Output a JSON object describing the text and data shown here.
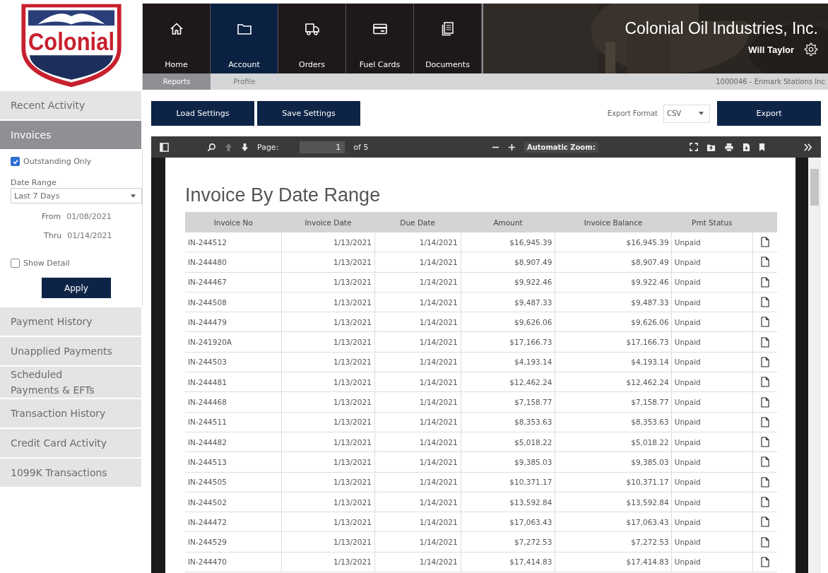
{
  "logo": {
    "text": "Colonial"
  },
  "sidebar": {
    "items_top": [
      {
        "label": "Recent Activity",
        "selected": false
      },
      {
        "label": "Invoices",
        "selected": true
      }
    ],
    "filters": {
      "outstanding": {
        "label": "Outstanding Only",
        "checked": true
      },
      "date_range": {
        "label": "Date Range",
        "value": "Last 7 Days"
      },
      "from": {
        "label": "From",
        "value": "01/08/2021"
      },
      "thru": {
        "label": "Thru",
        "value": "01/14/2021"
      },
      "show_detail": {
        "label": "Show Detail",
        "checked": false
      },
      "apply": "Apply"
    },
    "items_bottom": [
      {
        "label": "Payment History",
        "selected": false
      },
      {
        "label": "Unapplied Payments",
        "selected": false
      },
      {
        "label": "Scheduled Payments & EFTs",
        "selected": false
      },
      {
        "label": "Transaction History",
        "selected": false
      },
      {
        "label": "Credit Card Activity",
        "selected": false
      },
      {
        "label": "1099K Transactions",
        "selected": false
      }
    ]
  },
  "nav": {
    "tabs": [
      {
        "label": "Home",
        "kind": "home",
        "selected": false
      },
      {
        "label": "Account",
        "kind": "folder",
        "selected": true
      },
      {
        "label": "Orders",
        "kind": "truck",
        "selected": false
      },
      {
        "label": "Fuel Cards",
        "kind": "card",
        "selected": false
      },
      {
        "label": "Documents",
        "kind": "documents",
        "selected": false
      }
    ],
    "company": "Colonial Oil Industries, Inc.",
    "user": "Will Taylor",
    "subtabs": [
      {
        "label": "Reports",
        "selected": true
      },
      {
        "label": "Profile",
        "selected": false
      }
    ],
    "account": "1000046 - Enmark Stations Inc"
  },
  "toolbar": {
    "buttons": [
      "Load Settings",
      "Save Settings"
    ],
    "export_label": "Export Format",
    "export_format": "CSV",
    "export_button": "Export"
  },
  "viewer": {
    "page_label": "Page:",
    "page": "1",
    "page_count": "of 5",
    "zoom": "Automatic Zoom:"
  },
  "report": {
    "title": "Invoice By Date Range",
    "columns": [
      "Invoice No",
      "Invoice Date",
      "Due Date",
      "Amount",
      "Invoice Balance",
      "Pmt Status"
    ],
    "rows": [
      [
        "IN-244512",
        "1/13/2021",
        "1/14/2021",
        "$16,945.39",
        "$16,945.39",
        "Unpaid"
      ],
      [
        "IN-244480",
        "1/13/2021",
        "1/14/2021",
        "$8,907.49",
        "$8,907.49",
        "Unpaid"
      ],
      [
        "IN-244467",
        "1/13/2021",
        "1/14/2021",
        "$9,922.46",
        "$9,922.46",
        "Unpaid"
      ],
      [
        "IN-244508",
        "1/13/2021",
        "1/14/2021",
        "$9,487.33",
        "$9,487.33",
        "Unpaid"
      ],
      [
        "IN-244479",
        "1/13/2021",
        "1/14/2021",
        "$9,626.06",
        "$9,626.06",
        "Unpaid"
      ],
      [
        "IN-241920A",
        "1/13/2021",
        "1/14/2021",
        "$17,166.73",
        "$17,166.73",
        "Unpaid"
      ],
      [
        "IN-244503",
        "1/13/2021",
        "1/14/2021",
        "$4,193.14",
        "$4,193.14",
        "Unpaid"
      ],
      [
        "IN-244481",
        "1/13/2021",
        "1/14/2021",
        "$12,462.24",
        "$12,462.24",
        "Unpaid"
      ],
      [
        "IN-244468",
        "1/13/2021",
        "1/14/2021",
        "$7,158.77",
        "$7,158.77",
        "Unpaid"
      ],
      [
        "IN-244511",
        "1/13/2021",
        "1/14/2021",
        "$8,353.63",
        "$8,353.63",
        "Unpaid"
      ],
      [
        "IN-244482",
        "1/13/2021",
        "1/14/2021",
        "$5,018.22",
        "$5,018.22",
        "Unpaid"
      ],
      [
        "IN-244513",
        "1/13/2021",
        "1/14/2021",
        "$9,385.03",
        "$9,385.03",
        "Unpaid"
      ],
      [
        "IN-244505",
        "1/13/2021",
        "1/14/2021",
        "$10,371.17",
        "$10,371.17",
        "Unpaid"
      ],
      [
        "IN-244502",
        "1/13/2021",
        "1/14/2021",
        "$13,592.84",
        "$13,592.84",
        "Unpaid"
      ],
      [
        "IN-244472",
        "1/13/2021",
        "1/14/2021",
        "$17,063.43",
        "$17,063.43",
        "Unpaid"
      ],
      [
        "IN-244529",
        "1/13/2021",
        "1/14/2021",
        "$7,272.53",
        "$7,272.53",
        "Unpaid"
      ],
      [
        "IN-244470",
        "1/13/2021",
        "1/14/2021",
        "$17,414.83",
        "$17,414.83",
        "Unpaid"
      ]
    ]
  }
}
